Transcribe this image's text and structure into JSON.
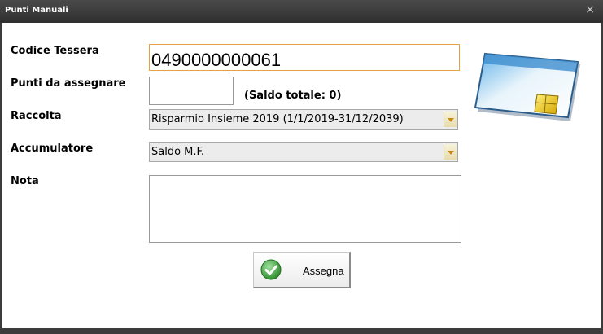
{
  "window": {
    "title": "Punti Manuali",
    "close_glyph": "×"
  },
  "form": {
    "codice_tessera_label": "Codice Tessera",
    "codice_tessera_value": "0490000000061",
    "punti_label": "Punti da assegnare",
    "punti_value": "",
    "saldo_text": "(Saldo totale: 0)",
    "raccolta_label": "Raccolta",
    "raccolta_value": "Risparmio Insieme 2019 (1/1/2019-31/12/2039)",
    "accumulatore_label": "Accumulatore",
    "accumulatore_value": "Saldo M.F.",
    "nota_label": "Nota",
    "nota_value": ""
  },
  "actions": {
    "assegna_label": "Assegna"
  },
  "icons": {
    "card": "smart-card-icon",
    "check": "check-circle-icon",
    "dropdown": "chevron-down-icon"
  },
  "colors": {
    "titlebar": "#3c3c3c",
    "focus_border": "#e3a243",
    "check_green": "#3aa63a"
  }
}
